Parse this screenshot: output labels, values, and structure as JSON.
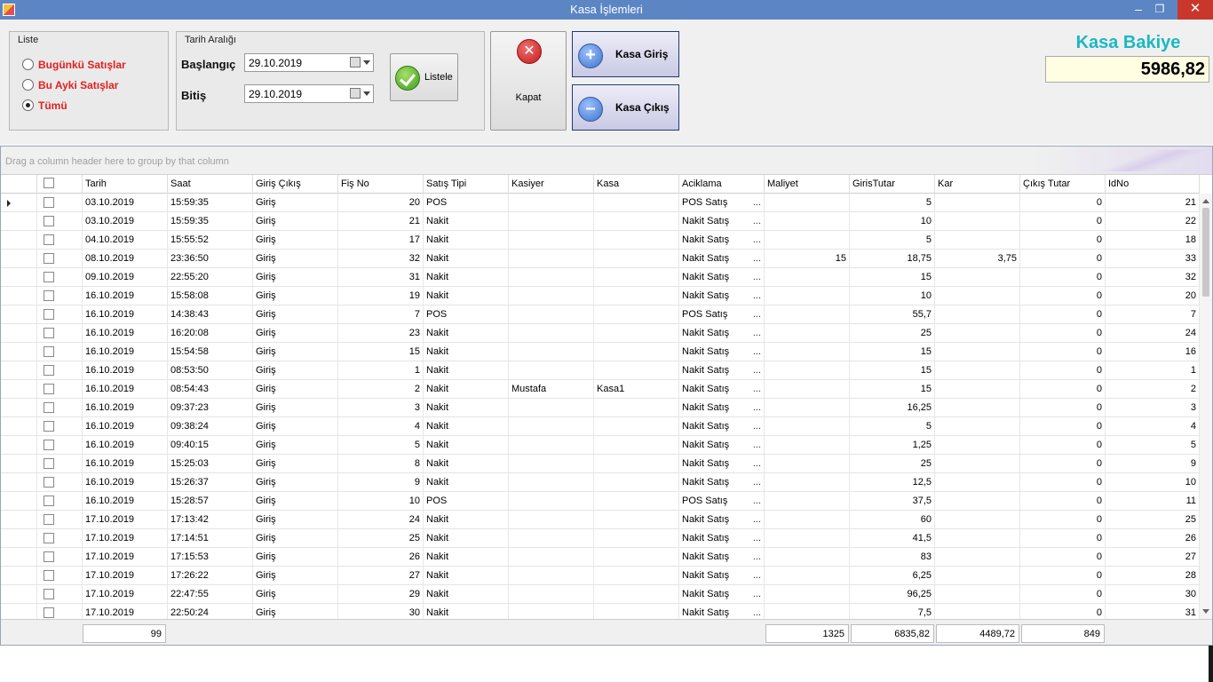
{
  "window": {
    "title": "Kasa İşlemleri",
    "minimize": "–",
    "maximize": "❐",
    "close": "✕"
  },
  "liste": {
    "caption": "Liste",
    "options": [
      {
        "label": "Bugünkü Satışlar",
        "selected": false
      },
      {
        "label": "Bu Ayki Satışlar",
        "selected": false
      },
      {
        "label": "Tümü",
        "selected": true
      }
    ]
  },
  "tarih": {
    "caption": "Tarih Aralığı",
    "start_label": "Başlangıç",
    "start_value": "29.10.2019",
    "end_label": "Bitiş",
    "end_value": "29.10.2019",
    "list_button": "Listele"
  },
  "kapat_label": "Kapat",
  "kasa_giris_label": "Kasa Giriş",
  "kasa_cikis_label": "Kasa Çıkış",
  "bakiye": {
    "title": "Kasa Bakiye",
    "value": "5986,82"
  },
  "grid": {
    "group_hint": "Drag a column header here to group by that column",
    "columns": [
      "Tarih",
      "Saat",
      "Giriş Çıkış",
      "Fiş No",
      "Satış Tipi",
      "Kasiyer",
      "Kasa",
      "Aciklama",
      "Maliyet",
      "GirisTutar",
      "Kar",
      "Çıkış Tutar",
      "IdNo"
    ],
    "rows": [
      [
        "03.10.2019",
        "15:59:35",
        "Giriş",
        "20",
        "POS",
        "",
        "",
        "POS Satış",
        "",
        "5",
        "",
        "0",
        "21"
      ],
      [
        "03.10.2019",
        "15:59:35",
        "Giriş",
        "21",
        "Nakit",
        "",
        "",
        "Nakit Satış",
        "",
        "10",
        "",
        "0",
        "22"
      ],
      [
        "04.10.2019",
        "15:55:52",
        "Giriş",
        "17",
        "Nakit",
        "",
        "",
        "Nakit Satış",
        "",
        "5",
        "",
        "0",
        "18"
      ],
      [
        "08.10.2019",
        "23:36:50",
        "Giriş",
        "32",
        "Nakit",
        "",
        "",
        "Nakit Satış",
        "15",
        "18,75",
        "3,75",
        "0",
        "33"
      ],
      [
        "09.10.2019",
        "22:55:20",
        "Giriş",
        "31",
        "Nakit",
        "",
        "",
        "Nakit Satış",
        "",
        "15",
        "",
        "0",
        "32"
      ],
      [
        "16.10.2019",
        "15:58:08",
        "Giriş",
        "19",
        "Nakit",
        "",
        "",
        "Nakit Satış",
        "",
        "10",
        "",
        "0",
        "20"
      ],
      [
        "16.10.2019",
        "14:38:43",
        "Giriş",
        "7",
        "POS",
        "",
        "",
        "POS Satış",
        "",
        "55,7",
        "",
        "0",
        "7"
      ],
      [
        "16.10.2019",
        "16:20:08",
        "Giriş",
        "23",
        "Nakit",
        "",
        "",
        "Nakit Satış",
        "",
        "25",
        "",
        "0",
        "24"
      ],
      [
        "16.10.2019",
        "15:54:58",
        "Giriş",
        "15",
        "Nakit",
        "",
        "",
        "Nakit Satış",
        "",
        "15",
        "",
        "0",
        "16"
      ],
      [
        "16.10.2019",
        "08:53:50",
        "Giriş",
        "1",
        "Nakit",
        "",
        "",
        "Nakit Satış",
        "",
        "15",
        "",
        "0",
        "1"
      ],
      [
        "16.10.2019",
        "08:54:43",
        "Giriş",
        "2",
        "Nakit",
        "Mustafa",
        "Kasa1",
        "Nakit Satış",
        "",
        "15",
        "",
        "0",
        "2"
      ],
      [
        "16.10.2019",
        "09:37:23",
        "Giriş",
        "3",
        "Nakit",
        "",
        "",
        "Nakit Satış",
        "",
        "16,25",
        "",
        "0",
        "3"
      ],
      [
        "16.10.2019",
        "09:38:24",
        "Giriş",
        "4",
        "Nakit",
        "",
        "",
        "Nakit Satış",
        "",
        "5",
        "",
        "0",
        "4"
      ],
      [
        "16.10.2019",
        "09:40:15",
        "Giriş",
        "5",
        "Nakit",
        "",
        "",
        "Nakit Satış",
        "",
        "1,25",
        "",
        "0",
        "5"
      ],
      [
        "16.10.2019",
        "15:25:03",
        "Giriş",
        "8",
        "Nakit",
        "",
        "",
        "Nakit Satış",
        "",
        "25",
        "",
        "0",
        "9"
      ],
      [
        "16.10.2019",
        "15:26:37",
        "Giriş",
        "9",
        "Nakit",
        "",
        "",
        "Nakit Satış",
        "",
        "12,5",
        "",
        "0",
        "10"
      ],
      [
        "16.10.2019",
        "15:28:57",
        "Giriş",
        "10",
        "POS",
        "",
        "",
        "POS Satış",
        "",
        "37,5",
        "",
        "0",
        "11"
      ],
      [
        "17.10.2019",
        "17:13:42",
        "Giriş",
        "24",
        "Nakit",
        "",
        "",
        "Nakit Satış",
        "",
        "60",
        "",
        "0",
        "25"
      ],
      [
        "17.10.2019",
        "17:14:51",
        "Giriş",
        "25",
        "Nakit",
        "",
        "",
        "Nakit Satış",
        "",
        "41,5",
        "",
        "0",
        "26"
      ],
      [
        "17.10.2019",
        "17:15:53",
        "Giriş",
        "26",
        "Nakit",
        "",
        "",
        "Nakit Satış",
        "",
        "83",
        "",
        "0",
        "27"
      ],
      [
        "17.10.2019",
        "17:26:22",
        "Giriş",
        "27",
        "Nakit",
        "",
        "",
        "Nakit Satış",
        "",
        "6,25",
        "",
        "0",
        "28"
      ],
      [
        "17.10.2019",
        "22:47:55",
        "Giriş",
        "29",
        "Nakit",
        "",
        "",
        "Nakit Satış",
        "",
        "96,25",
        "",
        "0",
        "30"
      ],
      [
        "17.10.2019",
        "22:50:24",
        "Giriş",
        "30",
        "Nakit",
        "",
        "",
        "Nakit Satış",
        "",
        "7,5",
        "",
        "0",
        "31"
      ]
    ],
    "ellipsis": "...",
    "footer": {
      "count": "99",
      "maliyet": "1325",
      "giris": "6835,82",
      "kar": "4489,72",
      "cikis": "849"
    }
  }
}
